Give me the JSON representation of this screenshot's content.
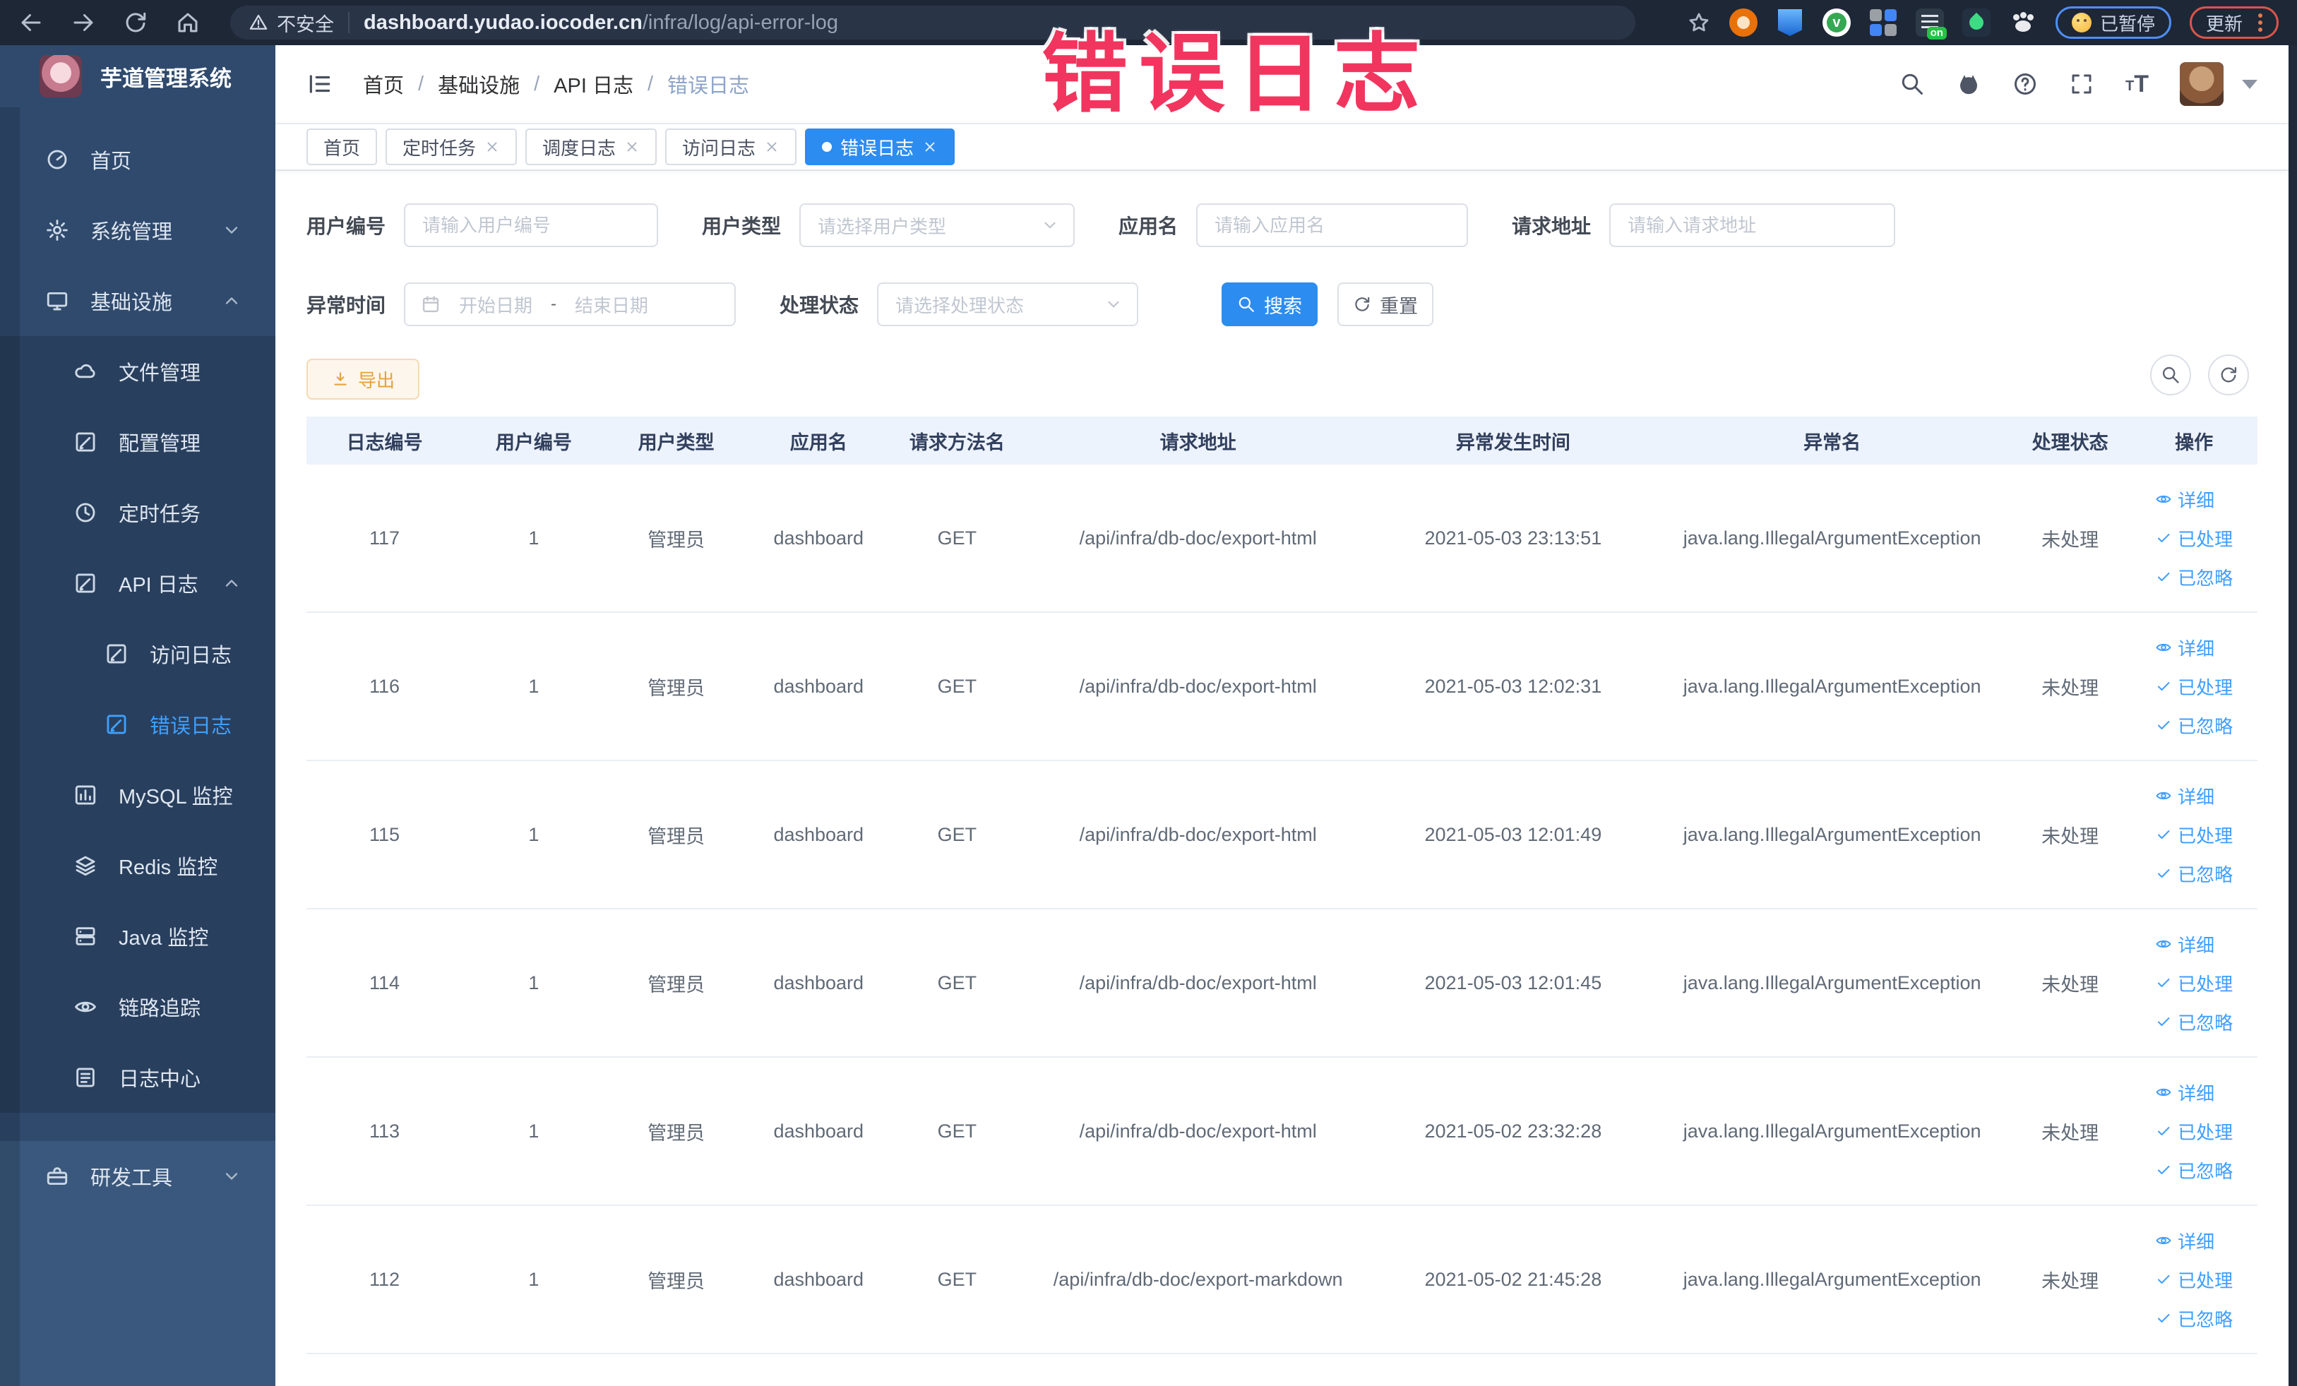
{
  "browser": {
    "security_label": "不安全",
    "url_domain": "dashboard.yudao.iocoder.cn",
    "url_path": "/infra/log/api-error-log",
    "nav_icons": [
      "back-icon",
      "forward-icon",
      "reload-icon",
      "home-icon"
    ],
    "extension_icons": [
      "bookmark-star-icon",
      "orange-extension-icon",
      "shield-extension-icon",
      "green-check-extension-icon",
      "grid-extension-icon",
      "proxy-extension-icon",
      "sprout-extension-icon",
      "paw-extension-icon"
    ],
    "proxy_badge": "on",
    "paused_badge_label": "已暂停",
    "update_button_label": "更新"
  },
  "watermark": {
    "text": "错误日志",
    "color": "#f2355e"
  },
  "sidebar": {
    "title": "芋道管理系统",
    "items": [
      {
        "label": "首页",
        "icon": "dashboard-icon",
        "level": 1
      },
      {
        "label": "系统管理",
        "icon": "gear-icon",
        "level": 1,
        "chevron": "down"
      },
      {
        "label": "基础设施",
        "icon": "monitor-icon",
        "level": 1,
        "chevron": "up"
      },
      {
        "label": "文件管理",
        "icon": "cloud-icon",
        "level": 2
      },
      {
        "label": "配置管理",
        "icon": "edit-icon",
        "level": 2
      },
      {
        "label": "定时任务",
        "icon": "clock-icon",
        "level": 2
      },
      {
        "label": "API 日志",
        "icon": "edit-icon",
        "level": 2,
        "chevron": "up"
      },
      {
        "label": "访问日志",
        "icon": "edit-icon",
        "level": 3
      },
      {
        "label": "错误日志",
        "icon": "edit-icon",
        "level": 3,
        "active": true
      },
      {
        "label": "MySQL 监控",
        "icon": "chart-icon",
        "level": 2
      },
      {
        "label": "Redis 监控",
        "icon": "layers-icon",
        "level": 2
      },
      {
        "label": "Java 监控",
        "icon": "server-icon",
        "level": 2
      },
      {
        "label": "链路追踪",
        "icon": "eye-icon",
        "level": 2
      },
      {
        "label": "日志中心",
        "icon": "log-icon",
        "level": 2
      },
      {
        "label": "研发工具",
        "icon": "toolbox-icon",
        "level": 1,
        "chevron": "down",
        "section": "light"
      }
    ]
  },
  "header": {
    "breadcrumb": [
      "首页",
      "基础设施",
      "API 日志",
      "错误日志"
    ],
    "separator": "/",
    "right_icons": [
      "search-icon",
      "github-icon",
      "help-icon",
      "fullscreen-icon",
      "font-size-icon",
      "avatar",
      "caret-down-icon"
    ]
  },
  "tabs": [
    {
      "label": "首页",
      "closable": false,
      "active": false
    },
    {
      "label": "定时任务",
      "closable": true,
      "active": false
    },
    {
      "label": "调度日志",
      "closable": true,
      "active": false
    },
    {
      "label": "访问日志",
      "closable": true,
      "active": false
    },
    {
      "label": "错误日志",
      "closable": true,
      "active": true
    }
  ],
  "filters": {
    "user_id": {
      "label": "用户编号",
      "placeholder": "请输入用户编号"
    },
    "user_type": {
      "label": "用户类型",
      "placeholder": "请选择用户类型"
    },
    "app_name": {
      "label": "应用名",
      "placeholder": "请输入应用名"
    },
    "request_url": {
      "label": "请求地址",
      "placeholder": "请输入请求地址"
    },
    "exception_time": {
      "label": "异常时间",
      "start_placeholder": "开始日期",
      "separator": "-",
      "end_placeholder": "结束日期"
    },
    "process_status": {
      "label": "处理状态",
      "placeholder": "请选择处理状态"
    },
    "search_label": "搜索",
    "reset_label": "重置"
  },
  "toolbar": {
    "export_label": "导出"
  },
  "table": {
    "headers": [
      "日志编号",
      "用户编号",
      "用户类型",
      "应用名",
      "请求方法名",
      "请求地址",
      "异常发生时间",
      "异常名",
      "处理状态",
      "操作"
    ],
    "row_actions": [
      {
        "label": "详细",
        "icon": "eye-icon"
      },
      {
        "label": "已处理",
        "icon": "check-icon"
      },
      {
        "label": "已忽略",
        "icon": "check-icon"
      }
    ],
    "rows": [
      {
        "id": "117",
        "user_id": "1",
        "user_type": "管理员",
        "app": "dashboard",
        "method": "GET",
        "url": "/api/infra/db-doc/export-html",
        "time": "2021-05-03 23:13:51",
        "exception": "java.lang.IllegalArgumentException",
        "status": "未处理"
      },
      {
        "id": "116",
        "user_id": "1",
        "user_type": "管理员",
        "app": "dashboard",
        "method": "GET",
        "url": "/api/infra/db-doc/export-html",
        "time": "2021-05-03 12:02:31",
        "exception": "java.lang.IllegalArgumentException",
        "status": "未处理"
      },
      {
        "id": "115",
        "user_id": "1",
        "user_type": "管理员",
        "app": "dashboard",
        "method": "GET",
        "url": "/api/infra/db-doc/export-html",
        "time": "2021-05-03 12:01:49",
        "exception": "java.lang.IllegalArgumentException",
        "status": "未处理"
      },
      {
        "id": "114",
        "user_id": "1",
        "user_type": "管理员",
        "app": "dashboard",
        "method": "GET",
        "url": "/api/infra/db-doc/export-html",
        "time": "2021-05-03 12:01:45",
        "exception": "java.lang.IllegalArgumentException",
        "status": "未处理"
      },
      {
        "id": "113",
        "user_id": "1",
        "user_type": "管理员",
        "app": "dashboard",
        "method": "GET",
        "url": "/api/infra/db-doc/export-html",
        "time": "2021-05-02 23:32:28",
        "exception": "java.lang.IllegalArgumentException",
        "status": "未处理"
      },
      {
        "id": "112",
        "user_id": "1",
        "user_type": "管理员",
        "app": "dashboard",
        "method": "GET",
        "url": "/api/infra/db-doc/export-markdown",
        "time": "2021-05-02 21:45:28",
        "exception": "java.lang.IllegalArgumentException",
        "status": "未处理"
      }
    ]
  },
  "colors": {
    "topbar_bg": "#1e2736",
    "sidebar_bg": "#2f4a6d",
    "accent_blue": "#2d8cf0",
    "link_blue": "#409eff",
    "warning_orange": "#e6a23c",
    "watermark_pink": "#f2355e",
    "table_header_bg": "#edf3fc"
  }
}
